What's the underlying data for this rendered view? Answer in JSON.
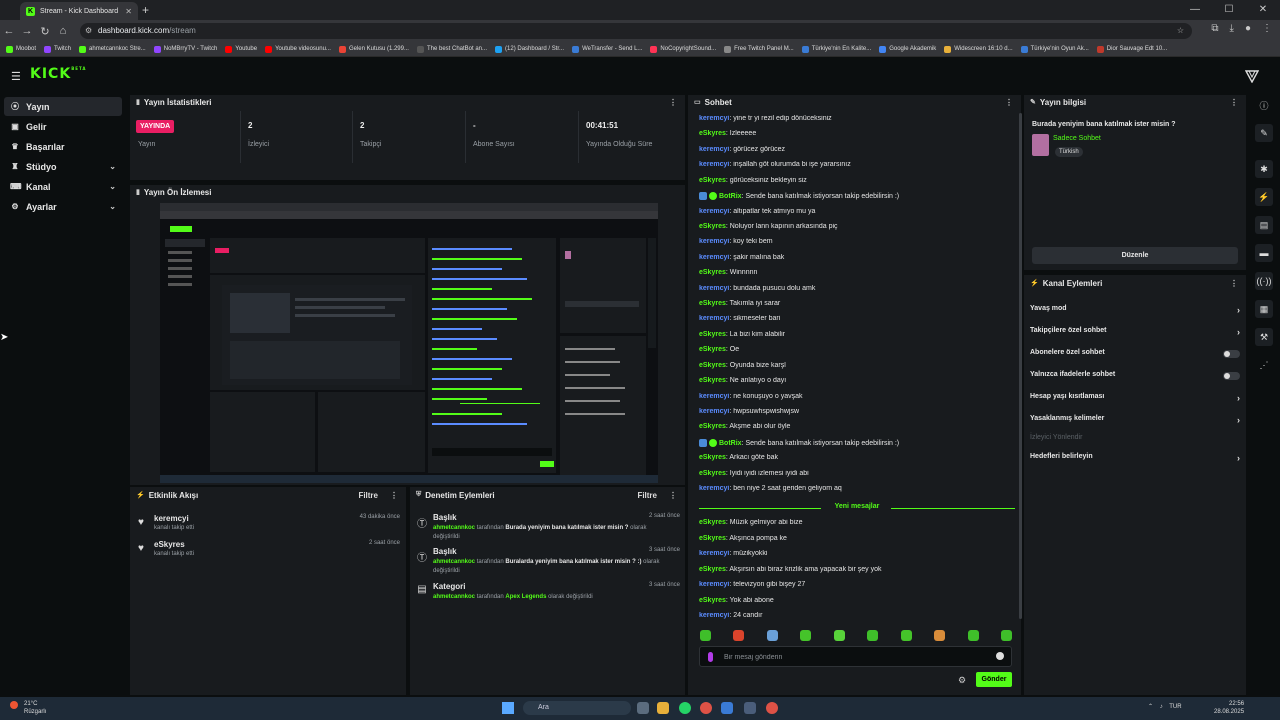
{
  "browser": {
    "tab_title": "Stream - Kick Dashboard",
    "url_host": "dashboard.kick.com",
    "url_path": "/stream",
    "bookmarks": [
      "Moobot",
      "Twitch",
      "ahmetcannkoc Stre...",
      "NoMBrryTV - Twitch",
      "Youtube",
      "Youtube videosunu...",
      "Gelen Kutusu (1.299...",
      "The best ChatBot an...",
      "(12) Dashboard / Str...",
      "WeTransfer - Send L...",
      "NoCopyrightSound...",
      "Free Twitch Panel M...",
      "Türkiye'nin En Kalite...",
      "Google Akademik",
      "Widescreen 16:10 d...",
      "Türkiye'nin Oyun Ak...",
      "Dior Sauvage Edt 10..."
    ]
  },
  "header": {
    "logo": "KICK",
    "beta": "BETA"
  },
  "sidebar": {
    "items": [
      {
        "label": "Yayın"
      },
      {
        "label": "Gelir"
      },
      {
        "label": "Başarılar"
      },
      {
        "label": "Stüdyo"
      },
      {
        "label": "Kanal"
      },
      {
        "label": "Ayarlar"
      }
    ]
  },
  "stats": {
    "title": "Yayın İstatistikleri",
    "cols": [
      {
        "value": "YAYINDA",
        "label": "Yayın"
      },
      {
        "value": "2",
        "label": "İzleyici"
      },
      {
        "value": "2",
        "label": "Takipçi"
      },
      {
        "value": "-",
        "label": "Abone Sayısı"
      },
      {
        "value": "00:41:51",
        "label": "Yayında Olduğu Süre"
      }
    ]
  },
  "preview": {
    "title": "Yayın Ön İzlemesi"
  },
  "activity": {
    "title": "Etkinlik Akışı",
    "filter": "Filtre",
    "items": [
      {
        "name": "keremcyi",
        "sub": "kanalı takip etti",
        "time": "43 dakika önce"
      },
      {
        "name": "eSkyres",
        "sub": "kanalı takip etti",
        "time": "2 saat önce"
      }
    ]
  },
  "moderation": {
    "title": "Denetim Eylemleri",
    "filter": "Filtre",
    "items": [
      {
        "type": "Başlık",
        "user": "ahmetcannkoc",
        "mid": "tarafından",
        "value": "Burada yeniyim bana katılmak ister misin ?",
        "end": "olarak değiştirildi",
        "time": "2 saat önce"
      },
      {
        "type": "Başlık",
        "user": "ahmetcannkoc",
        "mid": "tarafından",
        "value": "Buralarda yeniyim bana katılmak ister misin ? :)",
        "end": "olarak değiştirildi",
        "time": "3 saat önce"
      },
      {
        "type": "Kategori",
        "user": "ahmetcannkoc",
        "mid": "tarafından",
        "value": "Apex Legends",
        "end": "olarak değiştirildi",
        "time": "3 saat önce"
      }
    ]
  },
  "chat": {
    "title": "Sohbet",
    "messages": [
      {
        "user": "keremcyi",
        "text": ": yine tr yi rezil edip dönüceksiniz",
        "color": "#5b8cff"
      },
      {
        "user": "eSkyres",
        "text": ": İzleeeee",
        "color": "#53fc18"
      },
      {
        "user": "keremcyi",
        "text": ": görücez görücez",
        "color": "#5b8cff"
      },
      {
        "user": "keremcyi",
        "text": ": inşallah göt olurumda bi işe yararsınız",
        "color": "#5b8cff"
      },
      {
        "user": "eSkyres",
        "text": ": görüceksiniz bekleyin siz",
        "color": "#53fc18"
      },
      {
        "user": "BotRix",
        "text": ": Sende bana katılmak istiyorsan takip edebilirsin :)",
        "color": "#53fc18",
        "bot": true
      },
      {
        "user": "keremcyi",
        "text": ": altıpatlar tek atmıyo mu ya",
        "color": "#5b8cff"
      },
      {
        "user": "eSkyres",
        "text": ": Noluyor lann kapının arkasında piç",
        "color": "#53fc18"
      },
      {
        "user": "keremcyi",
        "text": ": koy teki bem",
        "color": "#5b8cff"
      },
      {
        "user": "keremcyi",
        "text": ": şakir malına bak",
        "color": "#5b8cff"
      },
      {
        "user": "eSkyres",
        "text": ": Winnnnn",
        "color": "#53fc18"
      },
      {
        "user": "keremcyi",
        "text": ": bundada pusucu dolu amk",
        "color": "#5b8cff"
      },
      {
        "user": "eSkyres",
        "text": ": Takımla iyi sarar",
        "color": "#53fc18"
      },
      {
        "user": "keremcyi",
        "text": ": sikmeseler bari",
        "color": "#5b8cff"
      },
      {
        "user": "eSkyres",
        "text": ": La bizi kim alabilir",
        "color": "#53fc18"
      },
      {
        "user": "eSkyres",
        "text": ": Oe",
        "color": "#53fc18"
      },
      {
        "user": "eSkyres",
        "text": ": Oyunda bize karşl",
        "color": "#53fc18"
      },
      {
        "user": "eSkyres",
        "text": ": Ne anlatıyo o dayı",
        "color": "#53fc18"
      },
      {
        "user": "keremcyi",
        "text": ": ne konuşuyo o yavşak",
        "color": "#5b8cff"
      },
      {
        "user": "keremcyi",
        "text": ": hwpsuwhspwishwjsw",
        "color": "#5b8cff"
      },
      {
        "user": "eSkyres",
        "text": ": Akşme abi olur öyle",
        "color": "#53fc18"
      },
      {
        "user": "BotRix",
        "text": ": Sende bana katılmak istiyorsan takip edebilirsin :)",
        "color": "#53fc18",
        "bot": true
      },
      {
        "user": "eSkyres",
        "text": ": Arkacı göte bak",
        "color": "#53fc18"
      },
      {
        "user": "eSkyres",
        "text": ": İyidi iyidi izlemesi iyidi abi",
        "color": "#53fc18"
      },
      {
        "user": "keremcyi",
        "text": ": ben niye 2 saat geriden geliyom aq",
        "color": "#5b8cff"
      }
    ],
    "new_messages_label": "Yeni mesajlar",
    "new_messages": [
      {
        "user": "eSkyres",
        "text": ": Müzik gelmiyor abi bize",
        "color": "#53fc18"
      },
      {
        "user": "eSkyres",
        "text": ": Akşınca pompa ke",
        "color": "#53fc18"
      },
      {
        "user": "keremcyi",
        "text": ": müzikyokki",
        "color": "#5b8cff"
      },
      {
        "user": "eSkyres",
        "text": ": Akşırsın abi biraz krizlik ama yapacak bir şey yok",
        "color": "#53fc18"
      },
      {
        "user": "keremcyi",
        "text": ": televizyon gibi bişey 27",
        "color": "#5b8cff"
      },
      {
        "user": "eSkyres",
        "text": ": Yok abi abone",
        "color": "#53fc18"
      },
      {
        "user": "keremcyi",
        "text": ": 24 candır",
        "color": "#5b8cff"
      }
    ],
    "input_placeholder": "Bir mesaj gönderin",
    "send_label": "Gönder"
  },
  "stream_info": {
    "title": "Yayın bilgisi",
    "stream_title": "Burada yeniyim bana katılmak ister misin ?",
    "category": "Sadece Sohbet",
    "tag": "Türkish",
    "edit_label": "Düzenle"
  },
  "channel_actions": {
    "title": "Kanal Eylemleri",
    "items": [
      {
        "label": "Yavaş mod",
        "kind": "chevron"
      },
      {
        "label": "Takipçilere özel sohbet",
        "kind": "chevron"
      },
      {
        "label": "Abonelere özel sohbet",
        "kind": "toggle"
      },
      {
        "label": "Yalnızca ifadelerle sohbet",
        "kind": "toggle"
      },
      {
        "label": "Hesap yaşı kısıtlaması",
        "kind": "chevron"
      },
      {
        "label": "Yasaklanmış kelimeler",
        "kind": "chevron"
      },
      {
        "label": "İzleyici Yönlendir",
        "kind": "disabled"
      },
      {
        "label": "Hedefleri belirleyin",
        "kind": "chevron"
      }
    ]
  },
  "taskbar": {
    "weather_temp": "21°C",
    "weather_desc": "Rüzgarlı",
    "search": "Ara",
    "lang": "TUR",
    "time": "22:56",
    "date": "28.08.2025"
  }
}
